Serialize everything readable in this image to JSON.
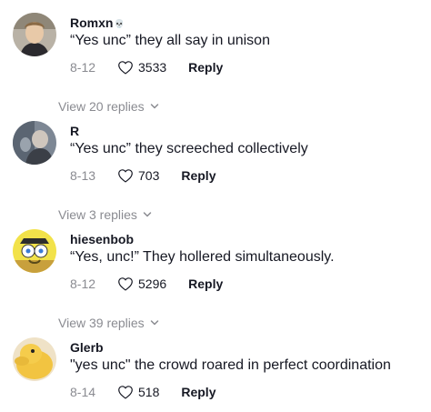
{
  "comments": [
    {
      "username": "Romxn",
      "badge": "💀",
      "text": "“Yes unc” they all say in unison",
      "date": "8-12",
      "likes": "3533",
      "reply_label": "Reply",
      "view_replies": "View 20 replies"
    },
    {
      "username": "R",
      "text": "“Yes unc” they screeched collectively",
      "date": "8-13",
      "likes": "703",
      "reply_label": "Reply",
      "view_replies": "View 3 replies"
    },
    {
      "username": "hiesenbob",
      "text": "“Yes, unc!” They hollered simultaneously.",
      "date": "8-12",
      "likes": "5296",
      "reply_label": "Reply",
      "view_replies": "View 39 replies"
    },
    {
      "username": "Glerb",
      "text": "\"yes unc\" the crowd roared in perfect coordination",
      "date": "8-14",
      "likes": "518",
      "reply_label": "Reply"
    }
  ],
  "icons": {
    "like": "heart-outline-icon",
    "expand": "chevron-down-icon"
  },
  "colors": {
    "text": "#161823",
    "muted": "#8a8b91",
    "background": "#ffffff"
  }
}
